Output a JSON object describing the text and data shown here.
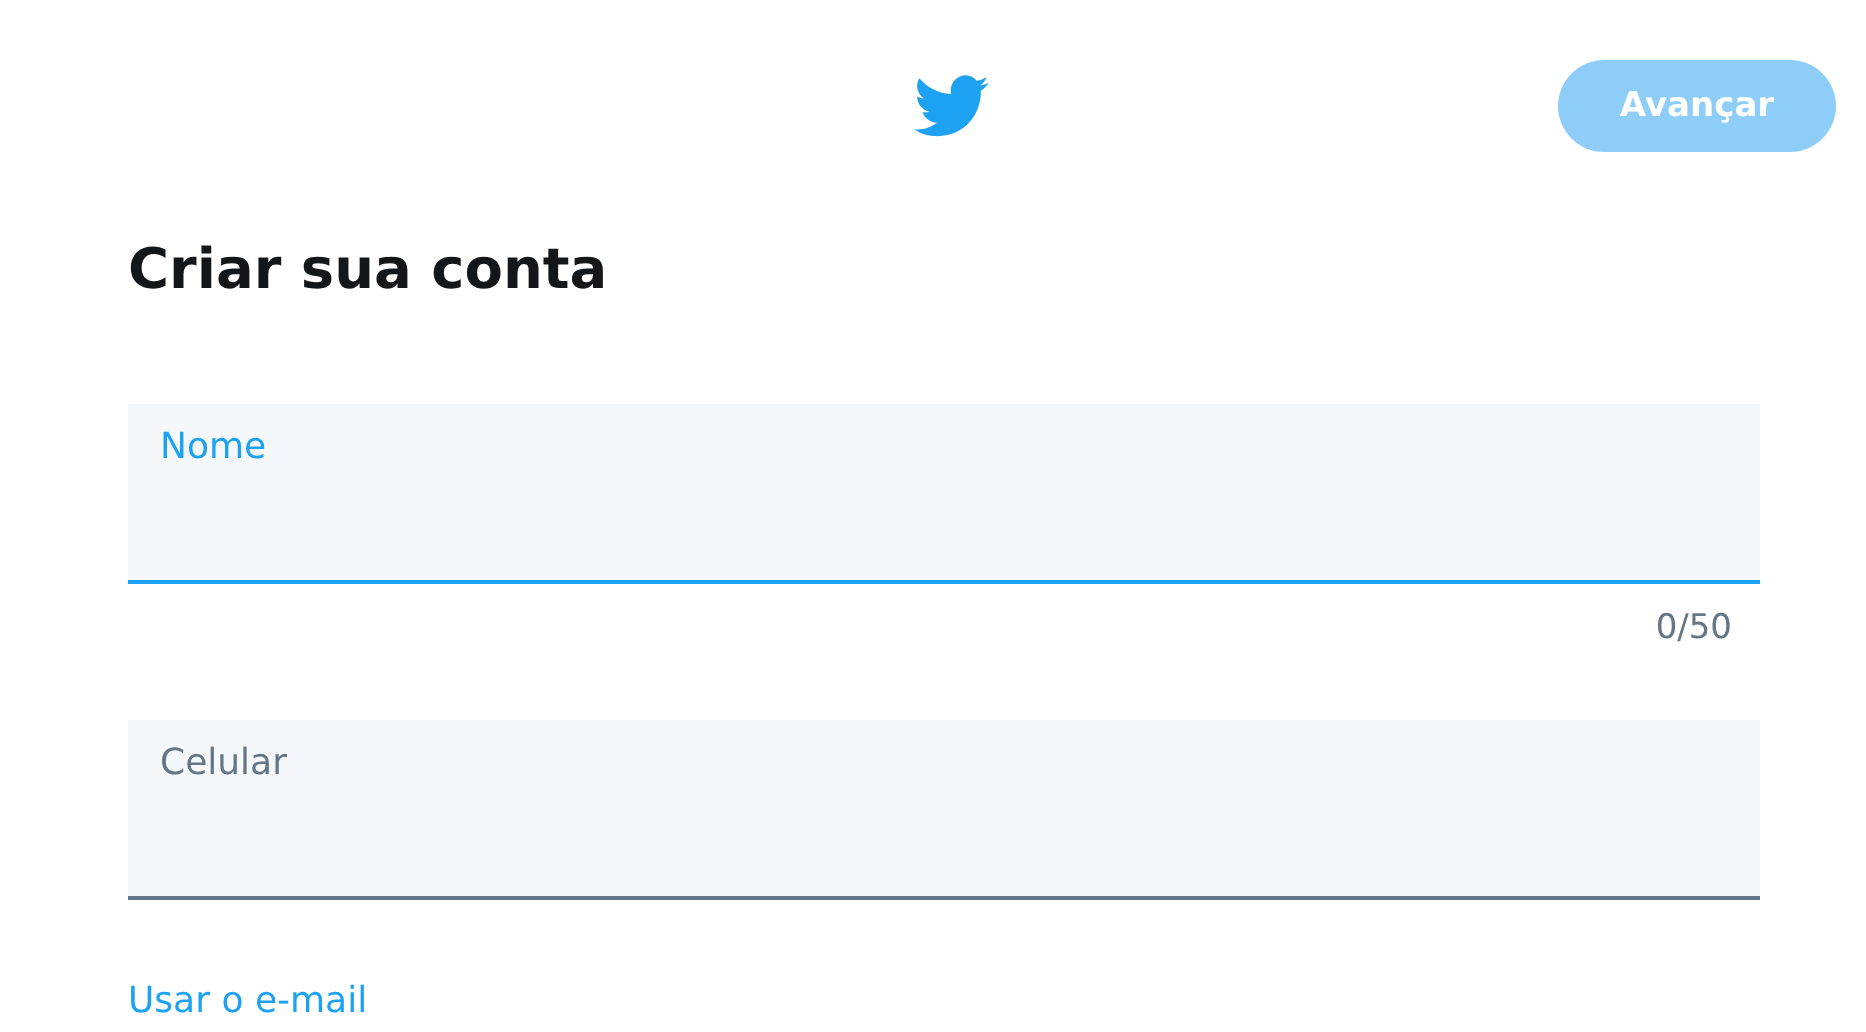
{
  "header": {
    "next_button": {
      "label": "Avançar",
      "disabled": true
    }
  },
  "title": "Criar sua conta",
  "fields": [
    {
      "label": "Nome",
      "focused": true,
      "counter": "0/50"
    },
    {
      "label": "Celular",
      "focused": false
    }
  ],
  "link": "Usar o e-mail"
}
